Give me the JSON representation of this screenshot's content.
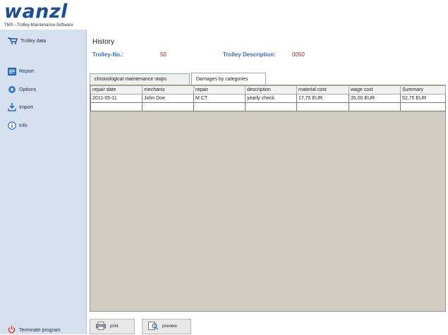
{
  "app": {
    "logo": "wanzl",
    "subtitle": "TMS - Trolley-Maintenance-Software"
  },
  "sidebar": {
    "items": [
      {
        "label": "Trolley data",
        "icon": "trolley-icon"
      },
      {
        "label": "Report",
        "icon": "report-icon"
      },
      {
        "label": "Options",
        "icon": "options-icon"
      },
      {
        "label": "Import",
        "icon": "import-icon"
      },
      {
        "label": "Info",
        "icon": "info-icon"
      }
    ],
    "terminate": "Terminate program"
  },
  "main": {
    "title": "History",
    "trolley_no_label": "Trolley-No.:",
    "trolley_no_value": "50",
    "trolley_desc_label": "Trolley Description:",
    "trolley_desc_value": "0050",
    "tabs": [
      {
        "label": "chronological maintenance stops"
      },
      {
        "label": "Damages by categories"
      }
    ],
    "table": {
      "columns": [
        "repair date",
        "mechanic",
        "repair",
        "description",
        "material cost",
        "wage cost",
        "Summary"
      ],
      "rows": [
        [
          "2011-05-11",
          "John Doe",
          "M CT",
          "yearly check",
          "17,75 EUR",
          "35,00 EUR",
          "52,75 EUR"
        ],
        [
          "",
          "",
          "",
          "",
          "",
          "",
          ""
        ]
      ]
    },
    "buttons": {
      "print": "print",
      "preview": "preview"
    }
  },
  "colors": {
    "brand": "#1d4f97",
    "sidebar": "#d6e1f0",
    "label": "#3a6fb8",
    "value": "#a12020",
    "grid_bg": "#d2cdc3"
  }
}
